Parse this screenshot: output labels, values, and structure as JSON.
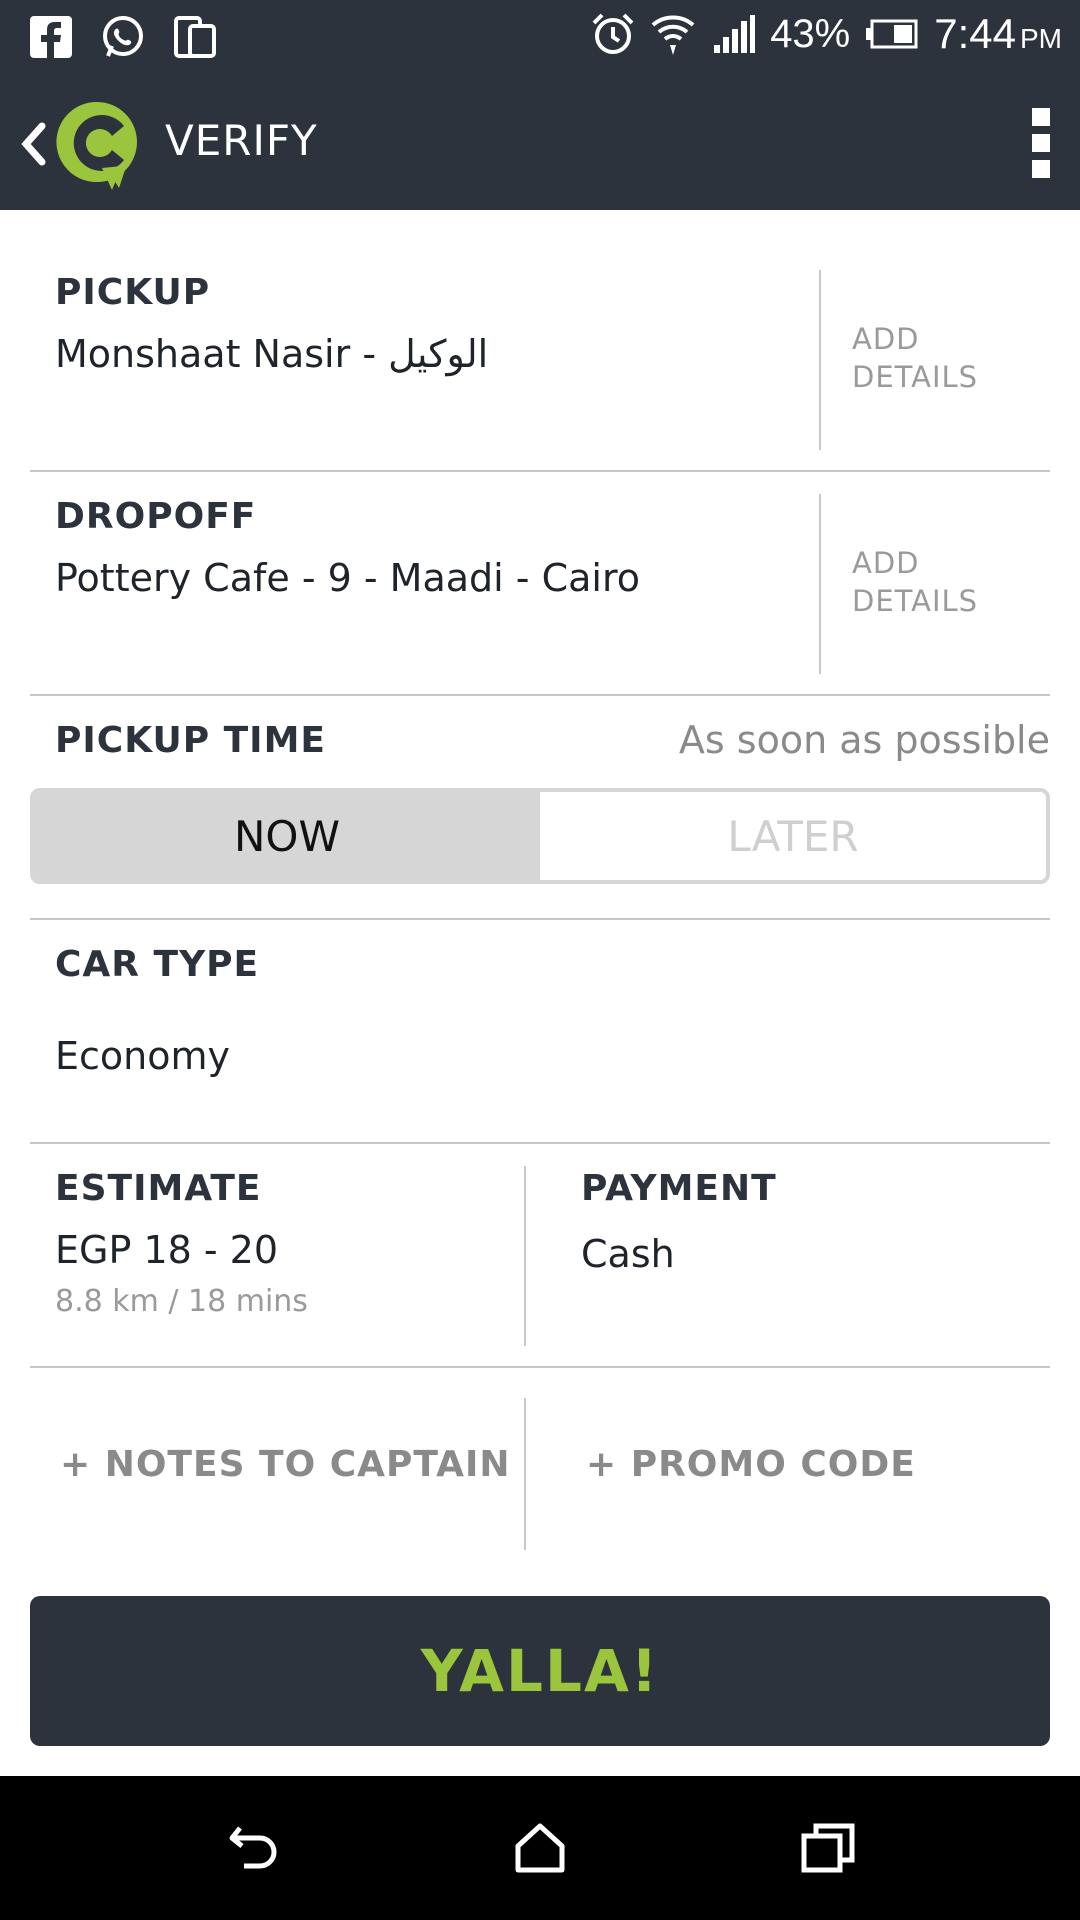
{
  "status_bar": {
    "battery": "43%",
    "time": "7:44",
    "ampm": "PM",
    "icons": [
      "facebook-icon",
      "whatsapp-icon",
      "dual-screen-icon",
      "alarm-icon",
      "wifi-icon",
      "signal-icon",
      "battery-icon"
    ]
  },
  "app_bar": {
    "title": "VERIFY",
    "brand_color": "#9bc53d"
  },
  "pickup": {
    "label": "PICKUP",
    "value": "Monshaat Nasir - الوكيل",
    "add_details": "ADD DETAILS"
  },
  "dropoff": {
    "label": "DROPOFF",
    "value": "Pottery Cafe  - 9 - Maadi - Cairo",
    "add_details": "ADD DETAILS"
  },
  "pickup_time": {
    "label": "PICKUP TIME",
    "value": "As soon as possible",
    "options": [
      "NOW",
      "LATER"
    ],
    "selected": "NOW"
  },
  "car_type": {
    "label": "CAR TYPE",
    "value": "Economy"
  },
  "estimate": {
    "label": "ESTIMATE",
    "value": "EGP 18 - 20",
    "detail": "8.8 km / 18 mins"
  },
  "payment": {
    "label": "PAYMENT",
    "value": "Cash"
  },
  "actions": {
    "notes": "+ NOTES TO CAPTAIN",
    "promo": "+ PROMO CODE"
  },
  "confirm_button": "YALLA!",
  "colors": {
    "header_bg": "#2c333c",
    "accent": "#9bc53d"
  }
}
